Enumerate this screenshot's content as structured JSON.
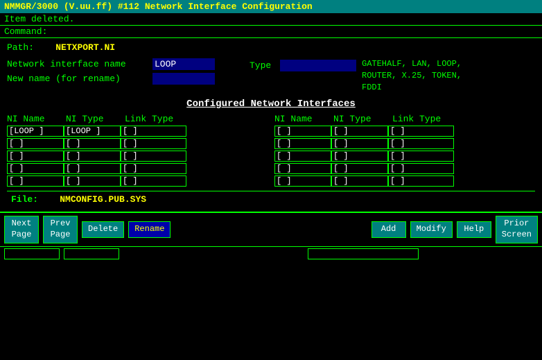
{
  "title_bar": {
    "text": "NMMGR/3000 (V.uu.ff) #112  Network Interface Configuration"
  },
  "status": {
    "item_deleted": "Item deleted."
  },
  "command_label": "Command:",
  "path": {
    "label": "Path:",
    "value": "NETXPORT.NI"
  },
  "form": {
    "ni_name_label": "Network interface name",
    "ni_name_value": "LOOP",
    "new_name_label": "New name (for rename)",
    "new_name_value": "",
    "type_label": "Type",
    "type_value": "",
    "type_options": "GATEHALF, LAN, LOOP,\nROUTER, X.25, TOKEN,\nFDDI"
  },
  "section_title": "Configured Network Interfaces",
  "table": {
    "headers": [
      "NI Name",
      "NI Type",
      "Link Type",
      "NI Name",
      "NI Type",
      "Link Type"
    ],
    "rows_left": [
      {
        "ni_name": "[LOOP    ]",
        "ni_type": "[LOOP    ]",
        "link_type": "[        ]"
      },
      {
        "ni_name": "[        ]",
        "ni_type": "[        ]",
        "link_type": "[        ]"
      },
      {
        "ni_name": "[        ]",
        "ni_type": "[        ]",
        "link_type": "[        ]"
      },
      {
        "ni_name": "[        ]",
        "ni_type": "[        ]",
        "link_type": "[        ]"
      },
      {
        "ni_name": "[        ]",
        "ni_type": "[        ]",
        "link_type": "[        ]"
      }
    ],
    "rows_right": [
      {
        "ni_name": "[        ]",
        "ni_type": "[        ]",
        "link_type": "[        ]"
      },
      {
        "ni_name": "[        ]",
        "ni_type": "[        ]",
        "link_type": "[        ]"
      },
      {
        "ni_name": "[        ]",
        "ni_type": "[        ]",
        "link_type": "[        ]"
      },
      {
        "ni_name": "[        ]",
        "ni_type": "[        ]",
        "link_type": "[        ]"
      },
      {
        "ni_name": "[        ]",
        "ni_type": "[        ]",
        "link_type": "[        ]"
      }
    ]
  },
  "file": {
    "label": "File:",
    "value": "NMCONFIG.PUB.SYS"
  },
  "buttons": [
    {
      "label": "Next\nPage",
      "name": "next-page-button"
    },
    {
      "label": "Prev\nPage",
      "name": "prev-page-button"
    },
    {
      "label": "Delete",
      "name": "delete-button"
    },
    {
      "label": "Rename",
      "name": "rename-button"
    },
    {
      "label": "Add",
      "name": "add-button"
    },
    {
      "label": "Modify",
      "name": "modify-button"
    },
    {
      "label": "Help",
      "name": "help-button"
    },
    {
      "label": "Prior\nScreen",
      "name": "prior-screen-button"
    }
  ]
}
